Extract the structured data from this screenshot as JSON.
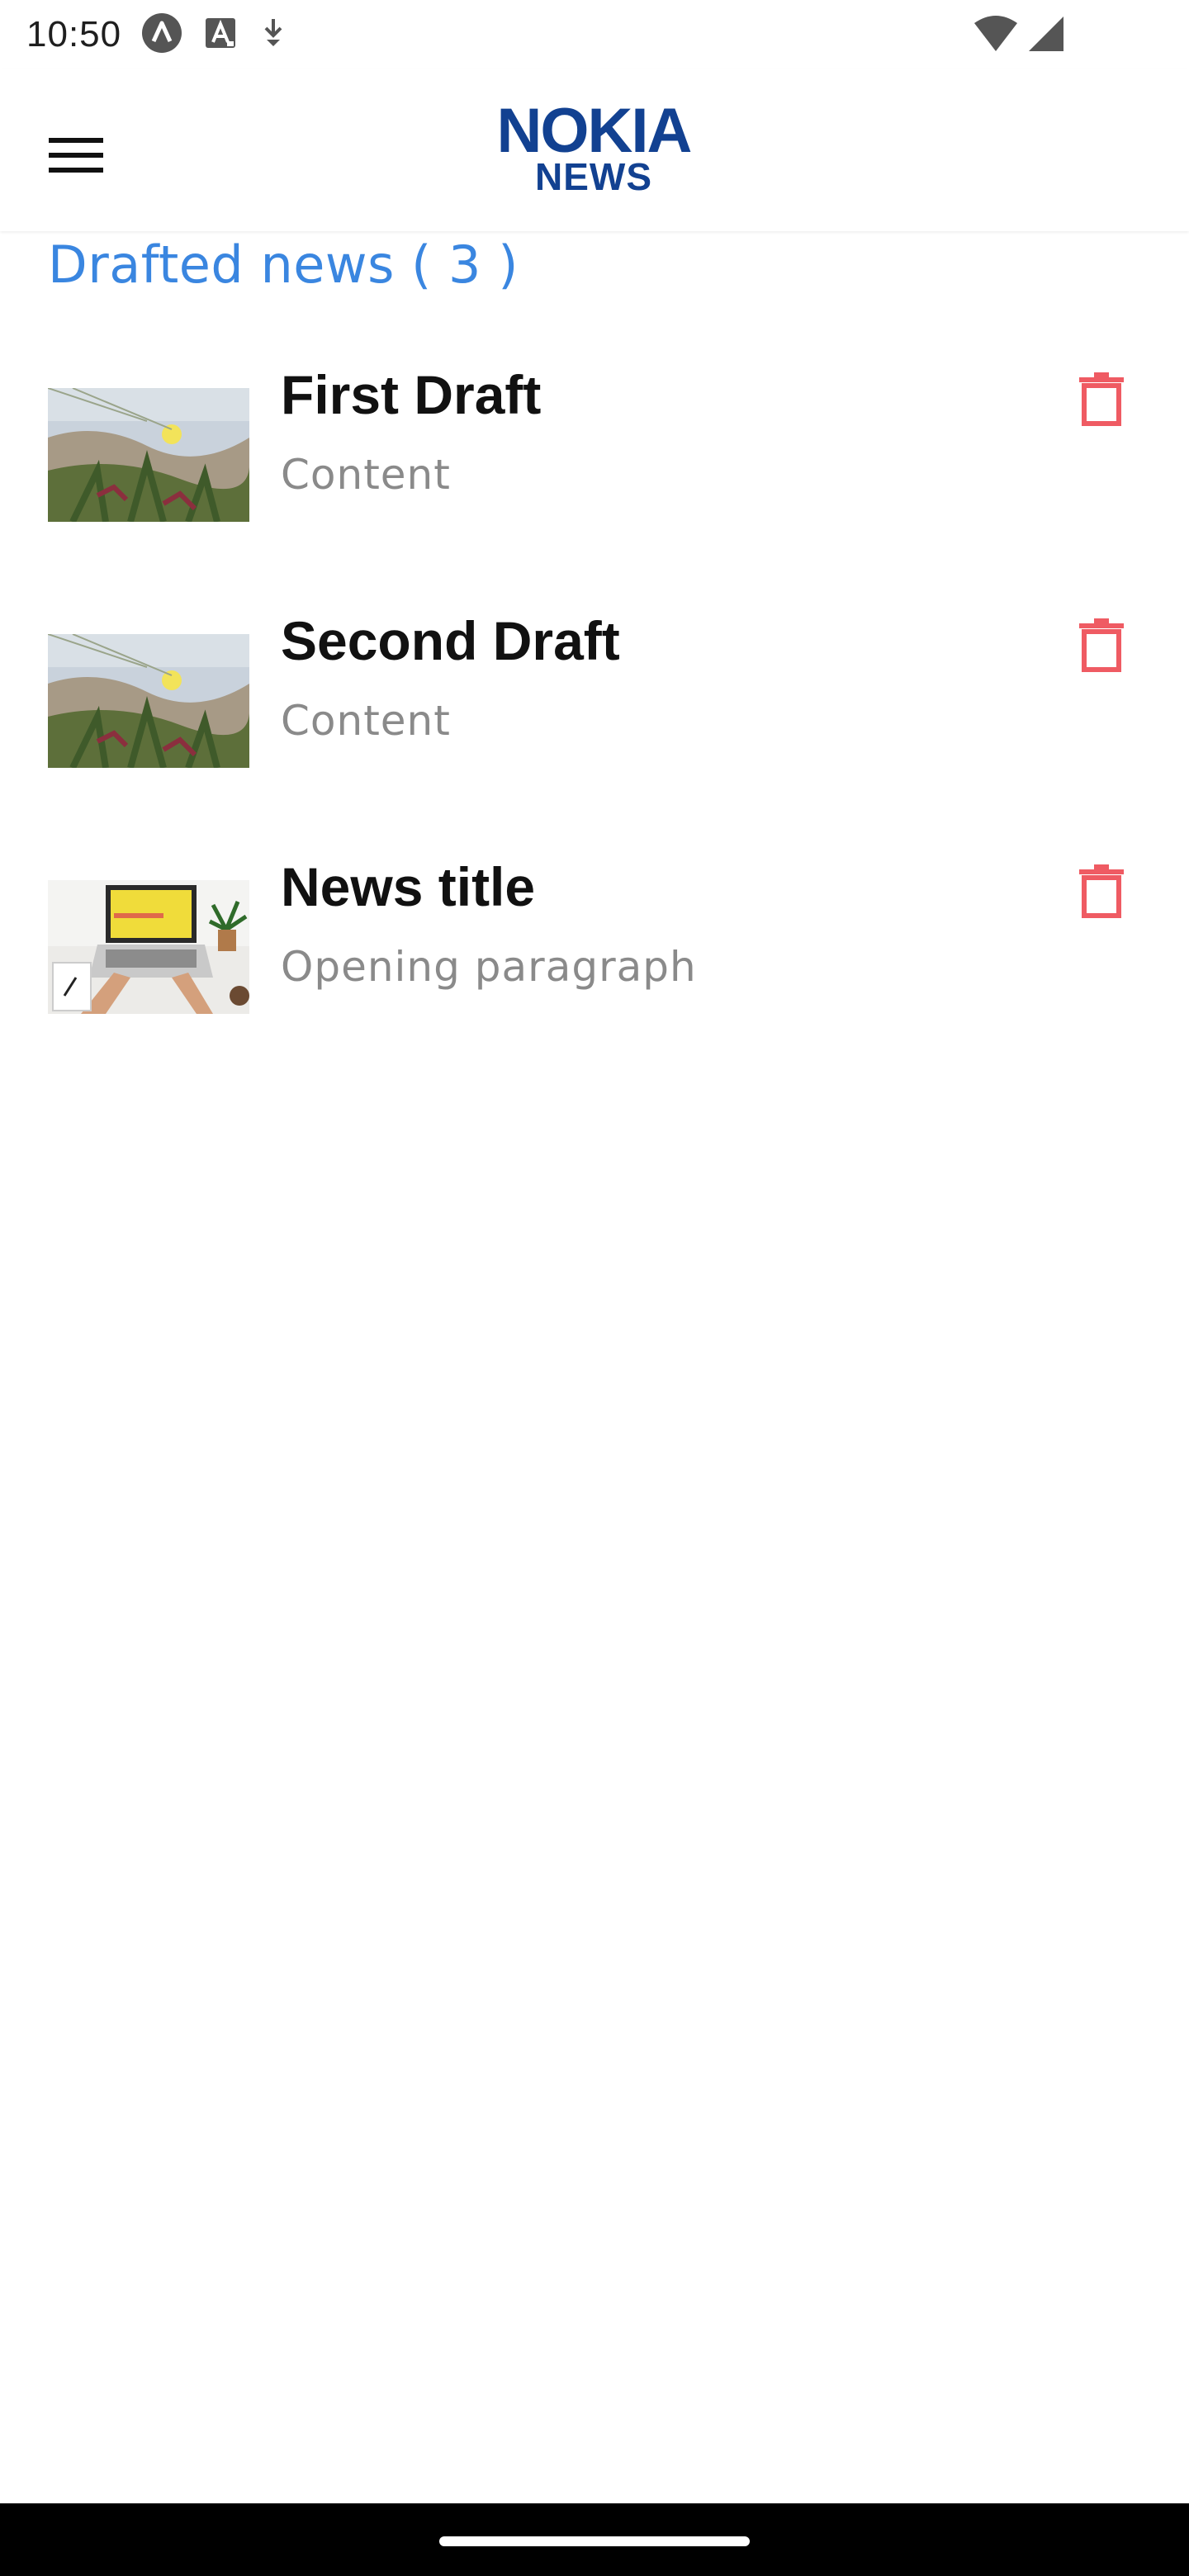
{
  "status_bar": {
    "time": "10:50",
    "icons_left": [
      "a-circle-icon",
      "a-box-icon",
      "download-icon"
    ],
    "icons_right": [
      "wifi-icon",
      "signal-icon"
    ]
  },
  "app_bar": {
    "menu_icon": "hamburger-menu-icon",
    "logo_line1": "NOKIA",
    "logo_line2": "NEWS",
    "logo_color": "#124191"
  },
  "section": {
    "title": "Drafted news ( 3 )",
    "title_color": "#3a86e0"
  },
  "drafts": [
    {
      "title": "First Draft",
      "subtitle": "Content",
      "thumbnail": "dune-plants-photo"
    },
    {
      "title": "Second Draft",
      "subtitle": "Content",
      "thumbnail": "dune-plants-photo"
    },
    {
      "title": "News title",
      "subtitle": "Opening paragraph",
      "thumbnail": "laptop-desk-photo"
    }
  ],
  "delete_icon": "trash-icon",
  "delete_color": "#ef5b63"
}
